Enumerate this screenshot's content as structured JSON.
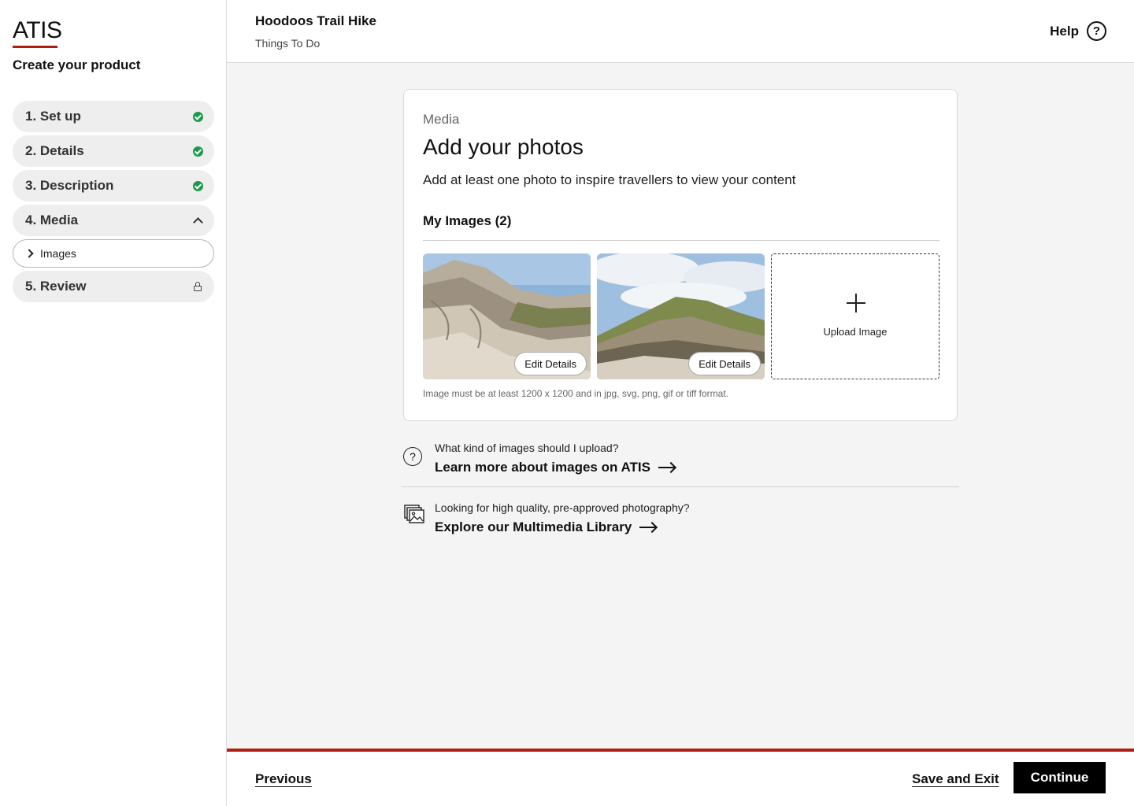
{
  "brand": {
    "logo": "ATIS",
    "accent_color": "#b01e12"
  },
  "sidebar": {
    "title": "Create your product",
    "steps": [
      {
        "label": "1. Set up",
        "status": "complete"
      },
      {
        "label": "2. Details",
        "status": "complete"
      },
      {
        "label": "3. Description",
        "status": "complete"
      },
      {
        "label": "4. Media",
        "status": "expanded"
      },
      {
        "label": "5. Review",
        "status": "locked"
      }
    ],
    "substeps": [
      {
        "label": "Images"
      }
    ]
  },
  "header": {
    "product_title": "Hoodoos Trail Hike",
    "product_category": "Things To Do",
    "help_label": "Help",
    "help_icon": "?"
  },
  "media": {
    "section_tag": "Media",
    "title": "Add your photos",
    "subtitle": "Add at least one photo to inspire travellers to view your content",
    "images_heading": "My Images (2)",
    "images": [
      {
        "edit_label": "Edit Details"
      },
      {
        "edit_label": "Edit Details"
      }
    ],
    "upload_label": "Upload Image",
    "hint": "Image must be at least  1200 x 1200 and in jpg, svg, png, gif or tiff format."
  },
  "info": [
    {
      "question": "What kind of images should I upload?",
      "link": "Learn more about images on ATIS",
      "icon": "question-circle-icon"
    },
    {
      "question": "Looking for high quality, pre-approved photography?",
      "link": "Explore our Multimedia Library",
      "icon": "image-library-icon"
    }
  ],
  "footer": {
    "previous": "Previous",
    "save_exit": "Save and Exit",
    "continue": "Continue"
  }
}
